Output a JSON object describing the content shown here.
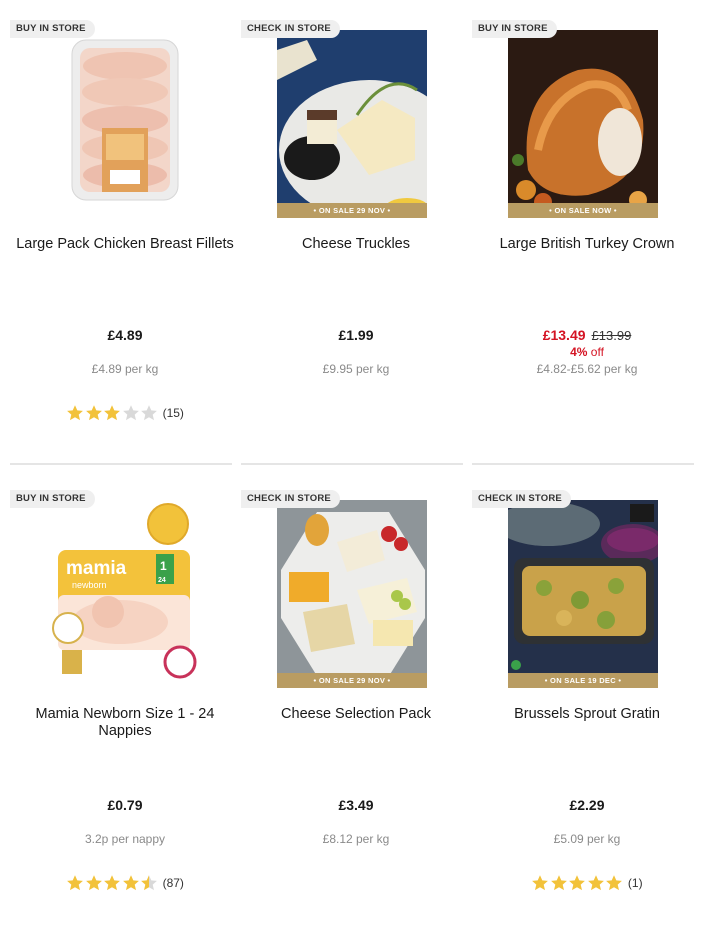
{
  "colors": {
    "accent_sale": "#d41323",
    "band_gold": "#b99c62",
    "star_fill": "#f2c23a",
    "star_empty": "#d9d9d9"
  },
  "products": [
    {
      "tag": "BUY IN STORE",
      "band": "",
      "name": "Large Pack Chicken Breast Fillets",
      "price": "£4.89",
      "was": "",
      "off_pct": "",
      "off_word": "",
      "unit": "£4.89 per kg",
      "rating": 3,
      "count": "(15)",
      "image": "raw-chicken-breast-pack"
    },
    {
      "tag": "CHECK IN STORE",
      "band": "• ON SALE 29 NOV •",
      "name": "Cheese Truckles",
      "price": "£1.99",
      "was": "",
      "off_pct": "",
      "off_word": "",
      "unit": "£9.95 per kg",
      "rating": null,
      "count": "",
      "image": "cheese-truckles-board"
    },
    {
      "tag": "BUY IN STORE",
      "band": "• ON SALE NOW •",
      "name": "Large British Turkey Crown",
      "price": "£13.49",
      "was": "£13.99",
      "off_pct": "4%",
      "off_word": "off",
      "unit": "£4.82-£5.62 per kg",
      "rating": null,
      "count": "",
      "image": "roast-turkey-crown"
    },
    {
      "tag": "BUY IN STORE",
      "band": "",
      "name": "Mamia Newborn Size 1 - 24 Nappies",
      "price": "£0.79",
      "was": "",
      "off_pct": "",
      "off_word": "",
      "unit": "3.2p per nappy",
      "rating": 4.5,
      "count": "(87)",
      "image": "mamia-nappies-pack",
      "pack_brand": "mamia",
      "pack_sub": "newborn",
      "pack_size": "1",
      "pack_count": "24"
    },
    {
      "tag": "CHECK IN STORE",
      "band": "• ON SALE 29 NOV •",
      "name": "Cheese Selection Pack",
      "price": "£3.49",
      "was": "",
      "off_pct": "",
      "off_word": "",
      "unit": "£8.12 per kg",
      "rating": null,
      "count": "",
      "image": "cheese-selection-platter"
    },
    {
      "tag": "CHECK IN STORE",
      "band": "• ON SALE 19 DEC •",
      "name": "Brussels Sprout Gratin",
      "price": "£2.29",
      "was": "",
      "off_pct": "",
      "off_word": "",
      "unit": "£5.09 per kg",
      "rating": 5,
      "count": "(1)",
      "image": "sprout-gratin-dish"
    }
  ]
}
